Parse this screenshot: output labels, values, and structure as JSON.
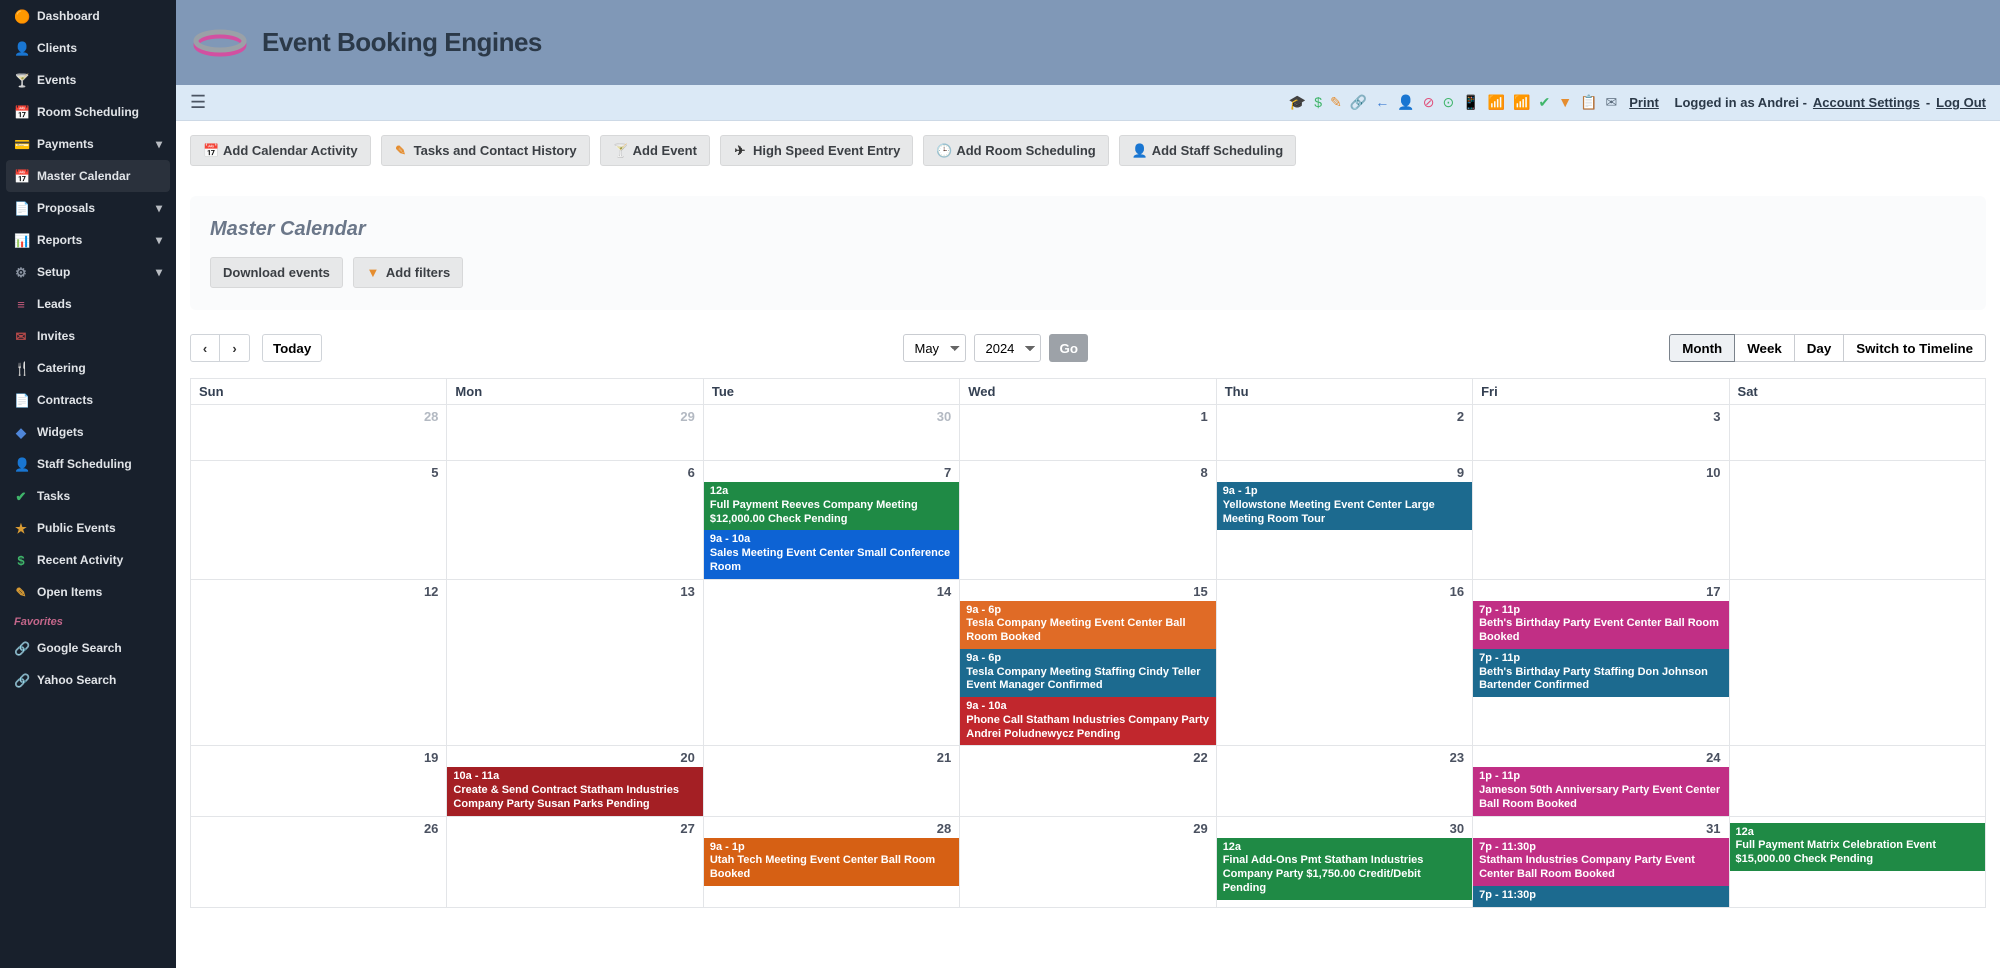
{
  "brand": "Event Booking Engines",
  "sidebar": {
    "items": [
      {
        "icon": "🟠",
        "label": "Dashboard",
        "color": "#e58d2f"
      },
      {
        "icon": "👤",
        "label": "Clients",
        "color": "#5ab7e6"
      },
      {
        "icon": "🍸",
        "label": "Events",
        "color": "#e04f7a"
      },
      {
        "icon": "📅",
        "label": "Room Scheduling",
        "color": "#4f86d9"
      },
      {
        "icon": "💳",
        "label": "Payments",
        "color": "#3fb56a",
        "sub": true
      },
      {
        "icon": "📅",
        "label": "Master Calendar",
        "color": "#b7852e",
        "active": true
      },
      {
        "icon": "📄",
        "label": "Proposals",
        "color": "#3fb56a",
        "sub": true
      },
      {
        "icon": "📊",
        "label": "Reports",
        "color": "#e58d2f",
        "sub": true
      },
      {
        "icon": "⚙",
        "label": "Setup",
        "color": "#8b94a2",
        "sub": true
      },
      {
        "icon": "≡",
        "label": "Leads",
        "color": "#c75a7c"
      },
      {
        "icon": "✉",
        "label": "Invites",
        "color": "#b84a4a"
      },
      {
        "icon": "🍴",
        "label": "Catering",
        "color": "#4f86d9"
      },
      {
        "icon": "📄",
        "label": "Contracts",
        "color": "#6db2e6"
      },
      {
        "icon": "◆",
        "label": "Widgets",
        "color": "#4f86d9"
      },
      {
        "icon": "👤",
        "label": "Staff Scheduling",
        "color": "#9a72c9"
      },
      {
        "icon": "✔",
        "label": "Tasks",
        "color": "#3fb56a"
      },
      {
        "icon": "★",
        "label": "Public Events",
        "color": "#d89b34"
      },
      {
        "icon": "$",
        "label": "Recent Activity",
        "color": "#3fb56a"
      },
      {
        "icon": "✎",
        "label": "Open Items",
        "color": "#d89b34"
      }
    ],
    "fav_header": "Favorites",
    "favorites": [
      {
        "icon": "🔗",
        "label": "Google Search",
        "color": "#d89b34"
      },
      {
        "icon": "🔗",
        "label": "Yahoo Search",
        "color": "#4f86d9"
      }
    ]
  },
  "topbar": {
    "print": "Print",
    "logged_in_prefix": "Logged in as Andrei -",
    "account_settings": "Account Settings",
    "logout": "Log Out",
    "miniicons": [
      {
        "glyph": "🎓",
        "color": "#1f5f7a",
        "name": "graduation-cap-icon"
      },
      {
        "glyph": "$",
        "color": "#3fb56a",
        "name": "dollar-icon"
      },
      {
        "glyph": "✎",
        "color": "#e58d2f",
        "name": "edit-icon"
      },
      {
        "glyph": "🔗",
        "color": "#d84a8b",
        "name": "link-icon"
      },
      {
        "glyph": "←",
        "color": "#3f7ed4",
        "name": "arrow-left-icon"
      },
      {
        "glyph": "👤",
        "color": "#5ab7e6",
        "name": "person-icon"
      },
      {
        "glyph": "⊘",
        "color": "#e04f7a",
        "name": "ban-icon"
      },
      {
        "glyph": "⊙",
        "color": "#3fb56a",
        "name": "target-icon"
      },
      {
        "glyph": "📱",
        "color": "#7bb86f",
        "name": "mobile-icon"
      },
      {
        "glyph": "📶",
        "color": "#e04f7a",
        "name": "signal-pink-icon"
      },
      {
        "glyph": "📶",
        "color": "#e58d2f",
        "name": "signal-orange-icon"
      },
      {
        "glyph": "✔",
        "color": "#3fb56a",
        "name": "check-icon"
      },
      {
        "glyph": "▼",
        "color": "#e58d2f",
        "name": "filter-icon"
      },
      {
        "glyph": "📋",
        "color": "#8b6f4a",
        "name": "clipboard-icon"
      },
      {
        "glyph": "✉",
        "color": "#5a6b7c",
        "name": "mail-icon"
      }
    ]
  },
  "actions": {
    "add_calendar_activity": "Add Calendar Activity",
    "tasks_contact_history": "Tasks and Contact History",
    "add_event": "Add Event",
    "high_speed": "High Speed Event Entry",
    "add_room": "Add Room Scheduling",
    "add_staff": "Add Staff Scheduling"
  },
  "panel": {
    "title": "Master Calendar",
    "download": "Download events",
    "add_filters": "Add filters"
  },
  "calendar": {
    "today": "Today",
    "month": "May",
    "year": "2024",
    "go": "Go",
    "views": {
      "month": "Month",
      "week": "Week",
      "day": "Day",
      "timeline": "Switch to Timeline"
    },
    "day_headers": [
      "Sun",
      "Mon",
      "Tue",
      "Wed",
      "Thu",
      "Fri",
      "Sat"
    ],
    "weeks": [
      {
        "days": [
          {
            "n": "28",
            "other": true,
            "events": []
          },
          {
            "n": "29",
            "other": true,
            "events": []
          },
          {
            "n": "30",
            "other": true,
            "events": []
          },
          {
            "n": "1",
            "events": []
          },
          {
            "n": "2",
            "events": []
          },
          {
            "n": "3",
            "events": []
          },
          {
            "n": "",
            "events": []
          }
        ]
      },
      {
        "days": [
          {
            "n": "5",
            "events": []
          },
          {
            "n": "6",
            "events": []
          },
          {
            "n": "7",
            "events": [
              {
                "time": "12a",
                "title": "Full Payment Reeves Company Meeting $12,000.00 Check Pending",
                "cls": "green"
              },
              {
                "time": "9a - 10a",
                "title": "Sales Meeting Event Center Small Conference Room",
                "cls": "blue"
              }
            ]
          },
          {
            "n": "8",
            "events": []
          },
          {
            "n": "9",
            "events": [
              {
                "time": "9a - 1p",
                "title": "Yellowstone Meeting Event Center Large Meeting Room Tour",
                "cls": "teal"
              }
            ]
          },
          {
            "n": "10",
            "events": []
          },
          {
            "n": "",
            "events": []
          }
        ]
      },
      {
        "days": [
          {
            "n": "12",
            "events": []
          },
          {
            "n": "13",
            "events": []
          },
          {
            "n": "14",
            "events": []
          },
          {
            "n": "15",
            "events": [
              {
                "time": "9a - 6p",
                "title": "Tesla Company Meeting Event Center Ball Room Booked",
                "cls": "orange"
              },
              {
                "time": "9a - 6p",
                "title": "Tesla Company Meeting Staffing Cindy Teller Event Manager Confirmed",
                "cls": "teal"
              },
              {
                "time": "9a - 10a",
                "title": "Phone Call Statham Industries Company Party Andrei Poludnewycz Pending",
                "cls": "red"
              }
            ]
          },
          {
            "n": "16",
            "events": []
          },
          {
            "n": "17",
            "events": [
              {
                "time": "7p - 11p",
                "title": "Beth's Birthday Party Event Center Ball Room Booked",
                "cls": "magenta"
              },
              {
                "time": "7p - 11p",
                "title": "Beth's Birthday Party Staffing Don Johnson Bartender Confirmed",
                "cls": "teal"
              }
            ]
          },
          {
            "n": "",
            "events": []
          }
        ]
      },
      {
        "days": [
          {
            "n": "19",
            "events": []
          },
          {
            "n": "20",
            "events": [
              {
                "time": "10a - 11a",
                "title": "Create & Send Contract Statham Industries Company Party Susan Parks Pending",
                "cls": "darkred"
              }
            ]
          },
          {
            "n": "21",
            "events": []
          },
          {
            "n": "22",
            "events": []
          },
          {
            "n": "23",
            "events": []
          },
          {
            "n": "24",
            "events": [
              {
                "time": "1p - 11p",
                "title": "Jameson 50th Anniversary Party Event Center Ball Room Booked",
                "cls": "magenta"
              }
            ]
          },
          {
            "n": "",
            "events": []
          }
        ]
      },
      {
        "days": [
          {
            "n": "26",
            "events": []
          },
          {
            "n": "27",
            "events": []
          },
          {
            "n": "28",
            "events": [
              {
                "time": "9a - 1p",
                "title": "Utah Tech Meeting Event Center Ball Room Booked",
                "cls": "darkorange"
              }
            ]
          },
          {
            "n": "29",
            "events": []
          },
          {
            "n": "30",
            "events": [
              {
                "time": "12a",
                "title": "Final Add-Ons Pmt Statham Industries Company Party $1,750.00 Credit/Debit Pending",
                "cls": "green"
              }
            ]
          },
          {
            "n": "31",
            "events": [
              {
                "time": "7p - 11:30p",
                "title": "Statham Industries Company Party Event Center Ball Room Booked",
                "cls": "magenta"
              },
              {
                "time": "7p - 11:30p",
                "title": "",
                "cls": "teal"
              }
            ]
          },
          {
            "n": "",
            "events": [
              {
                "time": "12a",
                "title": "Full Payment Matrix Celebration Event $15,000.00 Check Pending",
                "cls": "green"
              }
            ]
          }
        ]
      }
    ]
  }
}
